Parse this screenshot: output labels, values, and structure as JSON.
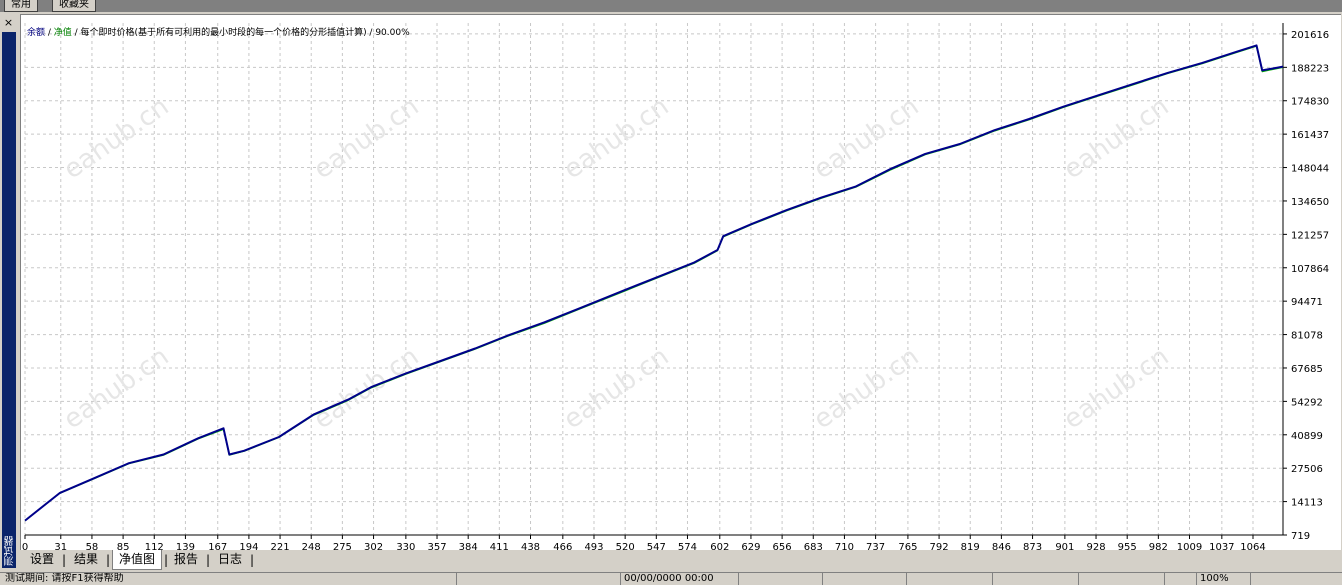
{
  "top_tabs": [
    "常用",
    "收藏夹"
  ],
  "sidebar": {
    "title": "测试器",
    "close_glyph": "×"
  },
  "chart": {
    "header": [
      {
        "text": "余额",
        "color": "#00007f"
      },
      {
        "text": " / ",
        "color": "#000000"
      },
      {
        "text": "净值",
        "color": "#008000"
      },
      {
        "text": " / 每个即时价格(基于所有可利用的最小时段的每一个价格的分形插值计算) / 90.00%",
        "color": "#000000"
      }
    ],
    "watermark": "eahub.cn",
    "colors": {
      "balance": "#00008b",
      "equity": "#00b000",
      "grid": "#c8c8c8",
      "axis": "#000000"
    }
  },
  "chart_data": {
    "type": "line",
    "x_ticks": [
      0,
      31,
      58,
      85,
      112,
      139,
      167,
      194,
      221,
      248,
      275,
      302,
      330,
      357,
      384,
      411,
      438,
      466,
      493,
      520,
      547,
      574,
      602,
      629,
      656,
      683,
      710,
      737,
      765,
      792,
      819,
      846,
      873,
      901,
      928,
      955,
      982,
      1009,
      1037,
      1064
    ],
    "y_ticks": [
      719,
      14113,
      27506,
      40899,
      54292,
      67685,
      81078,
      94471,
      107864,
      121257,
      134650,
      148044,
      161437,
      174830,
      188223,
      201616
    ],
    "xlim": [
      0,
      1090
    ],
    "ylim": [
      719,
      206000
    ],
    "series": [
      {
        "name": "余额",
        "x": [
          0,
          30,
          60,
          90,
          120,
          150,
          172,
          177,
          190,
          220,
          250,
          280,
          300,
          330,
          360,
          390,
          420,
          450,
          480,
          520,
          550,
          580,
          600,
          605,
          630,
          660,
          690,
          720,
          750,
          780,
          810,
          840,
          870,
          900,
          930,
          960,
          990,
          1020,
          1050,
          1067,
          1072,
          1090
        ],
        "y": [
          6500,
          17500,
          23500,
          29500,
          33000,
          39500,
          43500,
          33000,
          34500,
          40000,
          49000,
          55000,
          60000,
          65500,
          70500,
          75500,
          81000,
          86000,
          91500,
          99000,
          104500,
          110000,
          115000,
          120500,
          125500,
          131000,
          136000,
          140500,
          147500,
          153500,
          157500,
          163000,
          167500,
          172500,
          177000,
          181500,
          186000,
          190000,
          194500,
          197000,
          187000,
          188500
        ]
      },
      {
        "name": "净值",
        "x": [
          0,
          30,
          60,
          90,
          120,
          150,
          172,
          177,
          190,
          220,
          250,
          280,
          300,
          330,
          360,
          390,
          420,
          450,
          480,
          520,
          550,
          580,
          600,
          605,
          630,
          660,
          690,
          720,
          750,
          780,
          810,
          840,
          870,
          900,
          930,
          960,
          990,
          1020,
          1050,
          1067,
          1072,
          1090
        ],
        "y": [
          6500,
          17400,
          23300,
          29300,
          32700,
          39200,
          43000,
          32700,
          34300,
          39800,
          48700,
          54700,
          59700,
          65200,
          70200,
          75200,
          80700,
          85600,
          91200,
          98600,
          104200,
          109700,
          114700,
          120200,
          125200,
          130700,
          135700,
          140200,
          147100,
          153200,
          157200,
          162700,
          167200,
          172200,
          176700,
          181200,
          185700,
          189700,
          194200,
          196700,
          186500,
          188200
        ]
      }
    ]
  },
  "tabs": [
    "设置",
    "结果",
    "净值图",
    "报告",
    "日志"
  ],
  "active_tab": "净值图",
  "status": [
    "测试期间: 请按F1获得帮助",
    "",
    "00/00/0000 00:00",
    "",
    "",
    "",
    "",
    "",
    "",
    "",
    "100%"
  ]
}
